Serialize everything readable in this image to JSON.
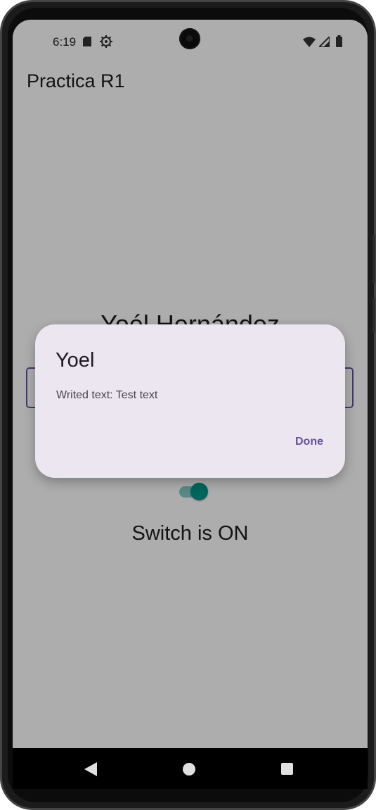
{
  "status_bar": {
    "time": "6:19",
    "icons": [
      "sd-card-icon",
      "gear-icon",
      "wifi-icon",
      "signal-icon",
      "battery-icon"
    ]
  },
  "app": {
    "title": "Practica R1",
    "name_heading": "Yoél Hernández",
    "switch": {
      "checked": true,
      "status_text": "Switch is ON"
    }
  },
  "dialog": {
    "title": "Yoel",
    "message": "Writed text: Test text",
    "confirm_label": "Done"
  },
  "nav_bar": {
    "buttons": [
      "back-icon",
      "home-icon",
      "recents-icon"
    ]
  },
  "colors": {
    "primary": "#6750a4",
    "dialog_surface": "#ece6f0",
    "switch_accent": "#009688"
  }
}
